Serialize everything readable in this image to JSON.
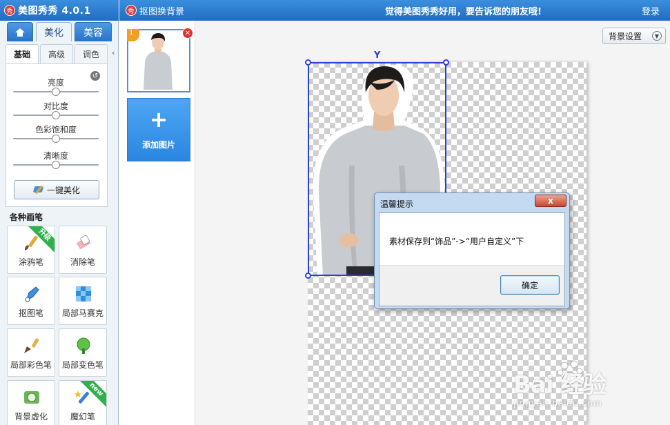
{
  "app": {
    "logo_glyph": "秀",
    "title": "美图秀秀 4.0.1"
  },
  "main_tabs": [
    {
      "label": "",
      "icon": "home-icon"
    },
    {
      "label": "美化",
      "active": true
    },
    {
      "label": "美容"
    }
  ],
  "sub_tabs": [
    {
      "label": "基础",
      "active": true
    },
    {
      "label": "高级"
    },
    {
      "label": "调色"
    }
  ],
  "adjustments": {
    "sliders": [
      {
        "label": "亮度",
        "value": 0.5
      },
      {
        "label": "对比度",
        "value": 0.5
      },
      {
        "label": "色彩饱和度",
        "value": 0.5
      },
      {
        "label": "清晰度",
        "value": 0.5
      }
    ],
    "one_click_label": "一键美化"
  },
  "brushes": {
    "header": "各种画笔",
    "items": [
      {
        "label": "涂鸦笔",
        "icon": "graffiti-brush-icon",
        "badge": "升级"
      },
      {
        "label": "消除笔",
        "icon": "eraser-icon"
      },
      {
        "label": "抠图笔",
        "icon": "cutout-pen-icon"
      },
      {
        "label": "局部马赛克",
        "icon": "mosaic-icon"
      },
      {
        "label": "局部彩色笔",
        "icon": "color-brush-icon"
      },
      {
        "label": "局部变色笔",
        "icon": "recolor-brush-icon"
      },
      {
        "label": "背景虚化",
        "icon": "blur-background-icon"
      },
      {
        "label": "魔幻笔",
        "icon": "magic-pen-icon",
        "badge": "new"
      }
    ]
  },
  "window": {
    "logo_glyph": "秀",
    "title": "抠图换背景",
    "slogan": "觉得美图秀秀好用，要告诉您的朋友哦!",
    "login": "登录"
  },
  "thumbnails": {
    "index": "1",
    "add_label": "添加图片",
    "add_glyph": "+"
  },
  "canvas": {
    "bg_settings_label": "背景设置"
  },
  "dialog": {
    "title": "温馨提示",
    "close_glyph": "x",
    "message": "素材保存到“饰品”->“用户自定义”下",
    "ok_label": "确定"
  },
  "watermark": {
    "logo": "Bai 经验",
    "url": "jingyan.baidu.com"
  },
  "colors": {
    "titlebar": "#2a7fd4",
    "add_button": "#3a96ea",
    "selection": "#2a3fd8",
    "ribbon_green": "#2fb24c"
  }
}
